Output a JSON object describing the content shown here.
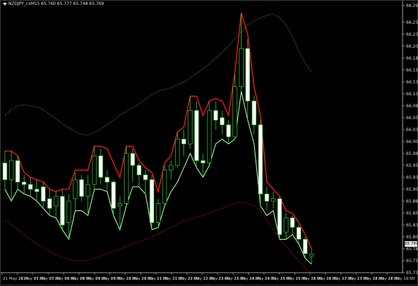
{
  "header": {
    "symbol_line": "NZDJPY_cxM15  65.760 65.777 65.748 65.769"
  },
  "current_price_tag": "65.769",
  "colors": {
    "background": "#000000",
    "bull_body": "#000000",
    "bear_body": "#ffffff",
    "candle_outline": "#2fcf2f",
    "upper_band": "#ff1a1a",
    "lower_band": "#a8f5a8",
    "outer_upper": "#21b121",
    "outer_lower": "#d41a1a"
  },
  "price_axis": {
    "min": 65.73,
    "max": 66.29,
    "labels": [
      "66.290",
      "66.255",
      "66.230",
      "66.205",
      "66.180",
      "66.155",
      "66.130",
      "66.105",
      "66.080",
      "66.055",
      "66.030",
      "66.005",
      "65.980",
      "65.955",
      "65.930",
      "65.905",
      "65.880",
      "65.855",
      "65.830",
      "65.805",
      "65.780",
      "65.755",
      "65.730"
    ]
  },
  "time_axis": {
    "labels": [
      "21 May 2020",
      "21 May 07:00",
      "21 May 07:30",
      "21 May 08:00",
      "21 May 08:30",
      "21 May 09:00",
      "21 May 09:30",
      "21 May 10:00",
      "21 May 10:30",
      "21 May 11:00",
      "21 May 11:30",
      "21 May 12:00",
      "21 May 12:30",
      "21 May 13:00",
      "21 May 13:30",
      "21 May 14:00",
      "21 May 14:30",
      "21 May 15:00",
      "21 May 15:30",
      "21 May 16:00",
      "21 May 16:30",
      "21 May 17:00",
      "21 May 17:30",
      "21 May 18:00",
      "21 May 18:30",
      "21 May 19:00"
    ]
  },
  "chart_data": {
    "type": "candlestick",
    "symbol": "NZDJPY_cxM15",
    "candles": [
      {
        "o": 65.96,
        "h": 65.985,
        "l": 65.905,
        "c": 65.925
      },
      {
        "o": 65.925,
        "h": 65.985,
        "l": 65.88,
        "c": 65.965
      },
      {
        "o": 65.965,
        "h": 65.975,
        "l": 65.905,
        "c": 65.92
      },
      {
        "o": 65.92,
        "h": 65.935,
        "l": 65.895,
        "c": 65.915
      },
      {
        "o": 65.915,
        "h": 65.93,
        "l": 65.89,
        "c": 65.905
      },
      {
        "o": 65.905,
        "h": 65.925,
        "l": 65.88,
        "c": 65.9
      },
      {
        "o": 65.91,
        "h": 65.92,
        "l": 65.865,
        "c": 65.88
      },
      {
        "o": 65.885,
        "h": 65.905,
        "l": 65.85,
        "c": 65.865
      },
      {
        "o": 65.87,
        "h": 65.9,
        "l": 65.845,
        "c": 65.89
      },
      {
        "o": 65.89,
        "h": 65.905,
        "l": 65.82,
        "c": 65.83
      },
      {
        "o": 65.835,
        "h": 65.895,
        "l": 65.8,
        "c": 65.88
      },
      {
        "o": 65.885,
        "h": 65.94,
        "l": 65.86,
        "c": 65.925
      },
      {
        "o": 65.925,
        "h": 65.935,
        "l": 65.88,
        "c": 65.89
      },
      {
        "o": 65.89,
        "h": 65.935,
        "l": 65.85,
        "c": 65.915
      },
      {
        "o": 65.915,
        "h": 65.995,
        "l": 65.905,
        "c": 65.975
      },
      {
        "o": 65.975,
        "h": 65.99,
        "l": 65.915,
        "c": 65.93
      },
      {
        "o": 65.93,
        "h": 65.945,
        "l": 65.9,
        "c": 65.92
      },
      {
        "o": 65.92,
        "h": 65.925,
        "l": 65.85,
        "c": 65.865
      },
      {
        "o": 65.87,
        "h": 65.89,
        "l": 65.82,
        "c": 65.875
      },
      {
        "o": 65.875,
        "h": 65.995,
        "l": 65.87,
        "c": 65.98
      },
      {
        "o": 65.98,
        "h": 65.99,
        "l": 65.92,
        "c": 65.955
      },
      {
        "o": 65.955,
        "h": 65.96,
        "l": 65.91,
        "c": 65.935
      },
      {
        "o": 65.935,
        "h": 65.945,
        "l": 65.895,
        "c": 65.925
      },
      {
        "o": 65.925,
        "h": 65.935,
        "l": 65.82,
        "c": 65.835
      },
      {
        "o": 65.835,
        "h": 65.885,
        "l": 65.825,
        "c": 65.875
      },
      {
        "o": 65.875,
        "h": 65.955,
        "l": 65.87,
        "c": 65.945
      },
      {
        "o": 65.945,
        "h": 65.965,
        "l": 65.925,
        "c": 65.955
      },
      {
        "o": 65.955,
        "h": 66.025,
        "l": 65.95,
        "c": 66.01
      },
      {
        "o": 66.01,
        "h": 66.03,
        "l": 65.975,
        "c": 66.0
      },
      {
        "o": 66.0,
        "h": 66.1,
        "l": 65.99,
        "c": 66.07
      },
      {
        "o": 66.07,
        "h": 66.09,
        "l": 65.95,
        "c": 65.965
      },
      {
        "o": 65.965,
        "h": 65.98,
        "l": 65.93,
        "c": 65.96
      },
      {
        "o": 65.96,
        "h": 66.09,
        "l": 65.955,
        "c": 66.07
      },
      {
        "o": 66.07,
        "h": 66.09,
        "l": 66.03,
        "c": 66.05
      },
      {
        "o": 66.055,
        "h": 66.07,
        "l": 66.02,
        "c": 66.04
      },
      {
        "o": 66.04,
        "h": 66.05,
        "l": 66.0,
        "c": 66.015
      },
      {
        "o": 66.015,
        "h": 66.145,
        "l": 66.01,
        "c": 66.12
      },
      {
        "o": 66.12,
        "h": 66.275,
        "l": 66.11,
        "c": 66.2
      },
      {
        "o": 66.2,
        "h": 66.22,
        "l": 66.05,
        "c": 66.09
      },
      {
        "o": 66.09,
        "h": 66.1,
        "l": 66.02,
        "c": 66.04
      },
      {
        "o": 66.04,
        "h": 66.05,
        "l": 65.87,
        "c": 65.895
      },
      {
        "o": 65.895,
        "h": 65.91,
        "l": 65.86,
        "c": 65.88
      },
      {
        "o": 65.88,
        "h": 65.9,
        "l": 65.865,
        "c": 65.885
      },
      {
        "o": 65.885,
        "h": 65.89,
        "l": 65.8,
        "c": 65.81
      },
      {
        "o": 65.815,
        "h": 65.855,
        "l": 65.8,
        "c": 65.845
      },
      {
        "o": 65.845,
        "h": 65.85,
        "l": 65.81,
        "c": 65.825
      },
      {
        "o": 65.825,
        "h": 65.83,
        "l": 65.79,
        "c": 65.8
      },
      {
        "o": 65.8,
        "h": 65.805,
        "l": 65.76,
        "c": 65.77
      },
      {
        "o": 65.765,
        "h": 65.78,
        "l": 65.748,
        "c": 65.769
      }
    ],
    "upper_band": [
      65.985,
      65.985,
      65.975,
      65.94,
      65.93,
      65.925,
      65.92,
      65.905,
      65.9,
      65.905,
      65.905,
      65.945,
      65.945,
      65.945,
      65.995,
      65.995,
      65.99,
      65.96,
      65.93,
      65.995,
      65.995,
      65.965,
      65.95,
      65.94,
      65.9,
      65.96,
      65.975,
      66.025,
      66.035,
      66.1,
      66.1,
      66.06,
      66.09,
      66.095,
      66.09,
      66.06,
      66.15,
      66.275,
      66.23,
      66.12,
      66.06,
      65.92,
      65.905,
      65.89,
      65.86,
      65.855,
      65.835,
      65.81,
      65.78
    ],
    "lower_band": [
      65.905,
      65.88,
      65.905,
      65.895,
      65.89,
      65.88,
      65.865,
      65.85,
      65.845,
      65.82,
      65.8,
      65.86,
      65.86,
      65.85,
      65.905,
      65.905,
      65.9,
      65.85,
      65.82,
      65.87,
      65.91,
      65.91,
      65.895,
      65.82,
      65.825,
      65.87,
      65.9,
      65.92,
      65.95,
      65.98,
      65.95,
      65.93,
      65.955,
      66.0,
      66.01,
      66.0,
      66.01,
      66.11,
      66.05,
      66.0,
      65.87,
      65.85,
      65.86,
      65.8,
      65.8,
      65.81,
      65.79,
      65.76,
      65.748
    ],
    "outer_upper": [
      66.06,
      66.072,
      66.08,
      66.082,
      66.08,
      66.078,
      66.072,
      66.062,
      66.052,
      66.042,
      66.034,
      66.026,
      66.02,
      66.018,
      66.024,
      66.032,
      66.04,
      66.05,
      66.06,
      66.068,
      66.076,
      66.084,
      66.094,
      66.104,
      66.11,
      66.114,
      66.118,
      66.124,
      66.13,
      66.138,
      66.148,
      66.158,
      66.168,
      66.18,
      66.192,
      66.205,
      66.22,
      66.235,
      66.25,
      66.258,
      66.264,
      66.27,
      66.272,
      66.265,
      66.25,
      66.225,
      66.195,
      66.17,
      66.15
    ],
    "outer_lower": [
      65.84,
      65.83,
      65.82,
      65.81,
      65.8,
      65.79,
      65.782,
      65.775,
      65.768,
      65.762,
      65.758,
      65.755,
      65.755,
      65.757,
      65.76,
      65.765,
      65.77,
      65.775,
      65.78,
      65.785,
      65.79,
      65.796,
      65.8,
      65.805,
      65.812,
      65.818,
      65.825,
      65.832,
      65.838,
      65.842,
      65.846,
      65.85,
      65.855,
      65.86,
      65.865,
      65.87,
      65.875,
      65.878,
      65.875,
      65.87,
      65.86,
      65.84,
      65.82,
      65.8,
      65.785,
      65.77,
      65.755,
      65.74,
      65.73
    ]
  }
}
